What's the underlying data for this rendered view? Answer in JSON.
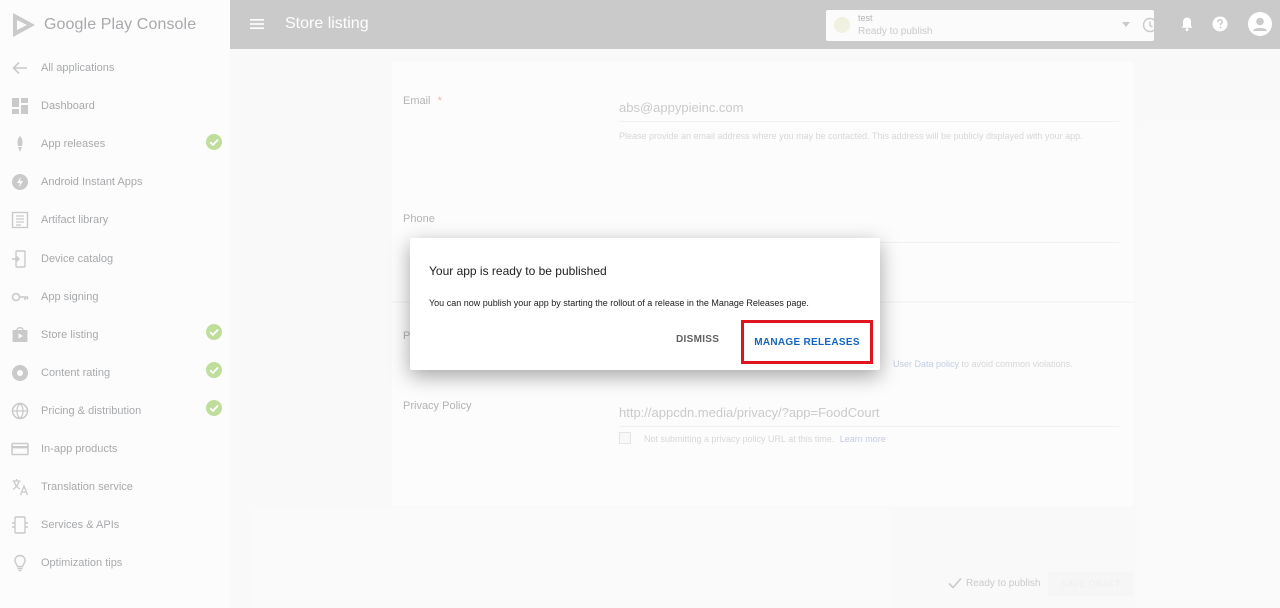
{
  "brand": {
    "name": "Google Play Console"
  },
  "topbar": {
    "page_title": "Store listing",
    "app_name": "test",
    "app_status": "Ready to publish"
  },
  "sidebar": {
    "items": [
      {
        "label": "All applications",
        "icon": "arrow-left-icon",
        "checked": false
      },
      {
        "label": "Dashboard",
        "icon": "dashboard-icon",
        "checked": false
      },
      {
        "label": "App releases",
        "icon": "rocket-icon",
        "checked": true
      },
      {
        "label": "Android Instant Apps",
        "icon": "instant-apps-icon",
        "checked": false
      },
      {
        "label": "Artifact library",
        "icon": "library-icon",
        "checked": false
      },
      {
        "label": "Device catalog",
        "icon": "device-icon",
        "checked": false
      },
      {
        "label": "App signing",
        "icon": "key-icon",
        "checked": false
      },
      {
        "label": "Store listing",
        "icon": "store-icon",
        "checked": true
      },
      {
        "label": "Content rating",
        "icon": "rating-icon",
        "checked": true
      },
      {
        "label": "Pricing & distribution",
        "icon": "globe-icon",
        "checked": true
      },
      {
        "label": "In-app products",
        "icon": "card-icon",
        "checked": false
      },
      {
        "label": "Translation service",
        "icon": "translate-icon",
        "checked": false
      },
      {
        "label": "Services & APIs",
        "icon": "services-icon",
        "checked": false
      },
      {
        "label": "Optimization tips",
        "icon": "lightbulb-icon",
        "checked": false
      }
    ]
  },
  "form": {
    "email_label": "Email",
    "email_required": "*",
    "email_value": "abs@appypieinc.com",
    "email_help": "Please provide an email address where you may be contacted. This address will be publicly displayed with your app.",
    "phone_label": "Phone",
    "policy_partial_label": "P",
    "policy_help_link": "User Data policy",
    "policy_help_tail": " to avoid common violations.",
    "privacy_label": "Privacy Policy",
    "privacy_value": "http://appcdn.media/privacy/?app=FoodCourt",
    "privacy_checkbox_label": "Not submitting a privacy policy URL at this time.",
    "learn_more": "Learn more"
  },
  "dialog": {
    "title": "Your app is ready to be published",
    "body": "You can now publish your app by starting the rollout of a release in the Manage Releases page.",
    "dismiss_label": "DISMISS",
    "manage_label": "MANAGE RELEASES"
  },
  "footer": {
    "status": "Ready to publish",
    "save_label": "SAVE DRAFT"
  },
  "colors": {
    "accent": "#1565c0",
    "highlight": "#e0141e",
    "check": "#8bc34a",
    "topbar": "#9e9e9e"
  }
}
